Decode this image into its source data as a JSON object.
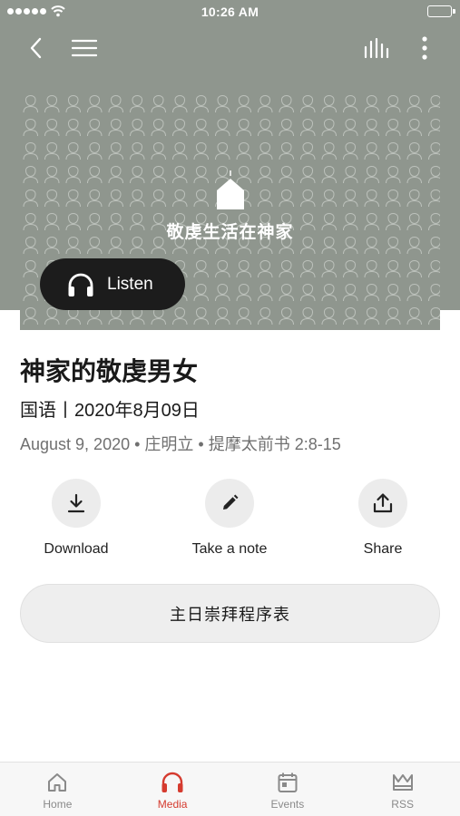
{
  "status_bar": {
    "time": "10:26 AM"
  },
  "artwork": {
    "title": "敬虔生活在神家"
  },
  "listen_button": {
    "label": "Listen"
  },
  "sermon": {
    "title": "神家的敬虔男女",
    "subtitle": "国语丨2020年8月09日",
    "meta": "August 9, 2020 • 庄明立 • 提摩太前书 2:8-15"
  },
  "actions": [
    {
      "label": "Download",
      "icon": "download-icon"
    },
    {
      "label": "Take a note",
      "icon": "pencil-icon"
    },
    {
      "label": "Share",
      "icon": "share-icon"
    }
  ],
  "order_button": {
    "label": "主日崇拜程序表"
  },
  "tabs": [
    {
      "label": "Home",
      "icon": "home-icon",
      "active": false
    },
    {
      "label": "Media",
      "icon": "headphones-icon",
      "active": true
    },
    {
      "label": "Events",
      "icon": "calendar-icon",
      "active": false
    },
    {
      "label": "RSS",
      "icon": "crown-icon",
      "active": false
    }
  ],
  "colors": {
    "header_background": "#8f968e",
    "active_tab": "#d53b2f",
    "listen_button": "#1c1c1c"
  }
}
